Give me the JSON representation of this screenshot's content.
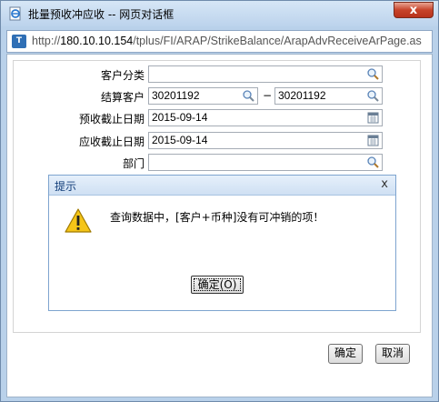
{
  "window": {
    "title": "批量预收冲应收 -- 网页对话框",
    "close_label": "x"
  },
  "address": {
    "protocol": "http://",
    "host": "180.10.10.154",
    "path": "/tplus/FI/ARAP/StrikeBalance/ArapAdvReceiveArPage.as"
  },
  "form": {
    "customer_category_label": "客户分类",
    "customer_category_value": "",
    "settle_customer_label": "结算客户",
    "settle_customer_from": "30201192",
    "settle_customer_to": "30201192",
    "range_separator": "−",
    "adv_receive_date_label": "预收截止日期",
    "adv_receive_date_value": "2015-09-14",
    "receivable_date_label": "应收截止日期",
    "receivable_date_value": "2015-09-14",
    "department_label": "部门",
    "department_value": ""
  },
  "dialog": {
    "title": "提示",
    "close_label": "x",
    "message": "查询数据中，[客户+币种]没有可冲销的项！",
    "ok_label": "确定(O)"
  },
  "footer": {
    "confirm_label": "确定",
    "cancel_label": "取消"
  },
  "icons": {
    "title": "ie-page-icon",
    "address": "site-icon",
    "lookup": "magnifier-icon",
    "date": "calendar-icon",
    "warning": "warning-icon"
  }
}
